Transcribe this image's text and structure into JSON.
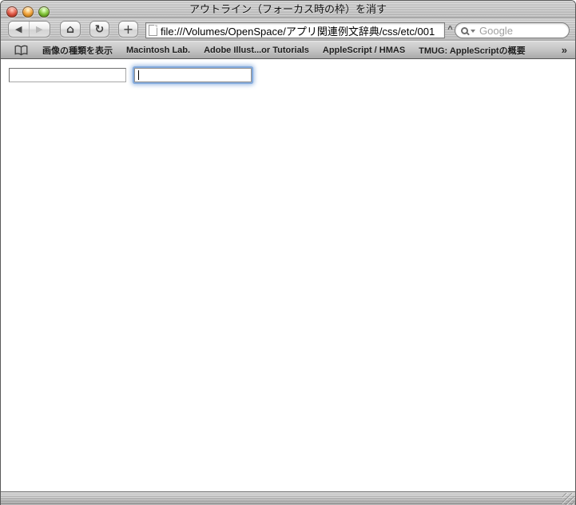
{
  "window": {
    "title": "アウトライン（フォーカス時の枠）を消す",
    "traffic_lights": {
      "close_color": "#e05a48",
      "minimize_color": "#f2a33c",
      "zoom_color": "#84c53c"
    }
  },
  "toolbar": {
    "icons": {
      "back": "◀",
      "forward": "▶",
      "home": "⌂",
      "reload": "↻",
      "add": "+",
      "snapback": "^"
    },
    "address": {
      "value": "file:///Volumes/OpenSpace/アプリ関連例文辞典/css/etc/001"
    },
    "search": {
      "placeholder": "Google"
    }
  },
  "bookmarks_bar": {
    "items": [
      "画像の種類を表示",
      "Macintosh Lab.",
      "Adobe Illust...or Tutorials",
      "AppleScript / HMAS",
      "TMUG: AppleScriptの概要"
    ],
    "overflow_chevron": "»"
  },
  "content": {
    "text_inputs": [
      {
        "value": "",
        "state": "normal"
      },
      {
        "value": "",
        "state": "focused"
      }
    ],
    "focus_ring_color": "#84abdd"
  }
}
